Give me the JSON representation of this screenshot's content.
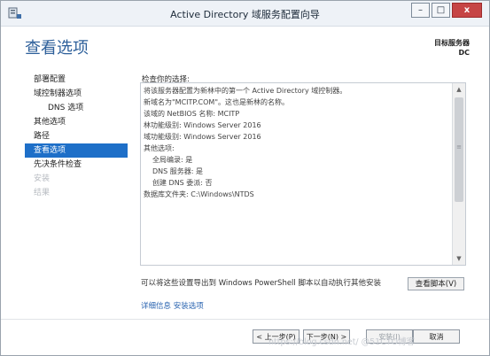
{
  "window": {
    "title": "Active Directory 域服务配置向导",
    "minimize": "–",
    "maximize": "□",
    "close": "x"
  },
  "page": {
    "heading": "查看选项",
    "target_server_label": "目标服务器",
    "target_server_name": "DC"
  },
  "nav": [
    {
      "label": "部署配置",
      "state": "normal"
    },
    {
      "label": "域控制器选项",
      "state": "normal"
    },
    {
      "label": "DNS 选项",
      "state": "sub"
    },
    {
      "label": "其他选项",
      "state": "normal"
    },
    {
      "label": "路径",
      "state": "normal"
    },
    {
      "label": "查看选项",
      "state": "active"
    },
    {
      "label": "先决条件检查",
      "state": "normal"
    },
    {
      "label": "安装",
      "state": "disabled"
    },
    {
      "label": "结果",
      "state": "disabled"
    }
  ],
  "review": {
    "label": "检查你的选择:",
    "lines": [
      {
        "text": "将该服务器配置为新林中的第一个 Active Directory 域控制器。",
        "indent": false
      },
      {
        "text": "新域名为\"MCITP.COM\"。这也是新林的名称。",
        "indent": false
      },
      {
        "text": "该域的 NetBIOS 名称: MCITP",
        "indent": false
      },
      {
        "text": "林功能级别: Windows Server 2016",
        "indent": false
      },
      {
        "text": "域功能级别: Windows Server 2016",
        "indent": false
      },
      {
        "text": "其他选项:",
        "indent": false
      },
      {
        "text": "全局编录: 是",
        "indent": true
      },
      {
        "text": "DNS 服务器: 是",
        "indent": true
      },
      {
        "text": "创建 DNS 委派: 否",
        "indent": true
      },
      {
        "text": "数据库文件夹: C:\\Windows\\NTDS",
        "indent": false
      }
    ]
  },
  "scrollbar": {
    "up": "▲",
    "down": "▼",
    "grip": "≡"
  },
  "export": {
    "text": "可以将这些设置导出到 Windows PowerShell 脚本以自动执行其他安装",
    "button": "查看脚本(V)"
  },
  "more_info_link": "详细信息 安装选项",
  "buttons": {
    "previous": "< 上一步(P)",
    "next": "下一步(N) >",
    "install": "安装(I)",
    "cancel": "取消"
  },
  "watermark": "https://blog.csdn.net/ @51CTO博客"
}
